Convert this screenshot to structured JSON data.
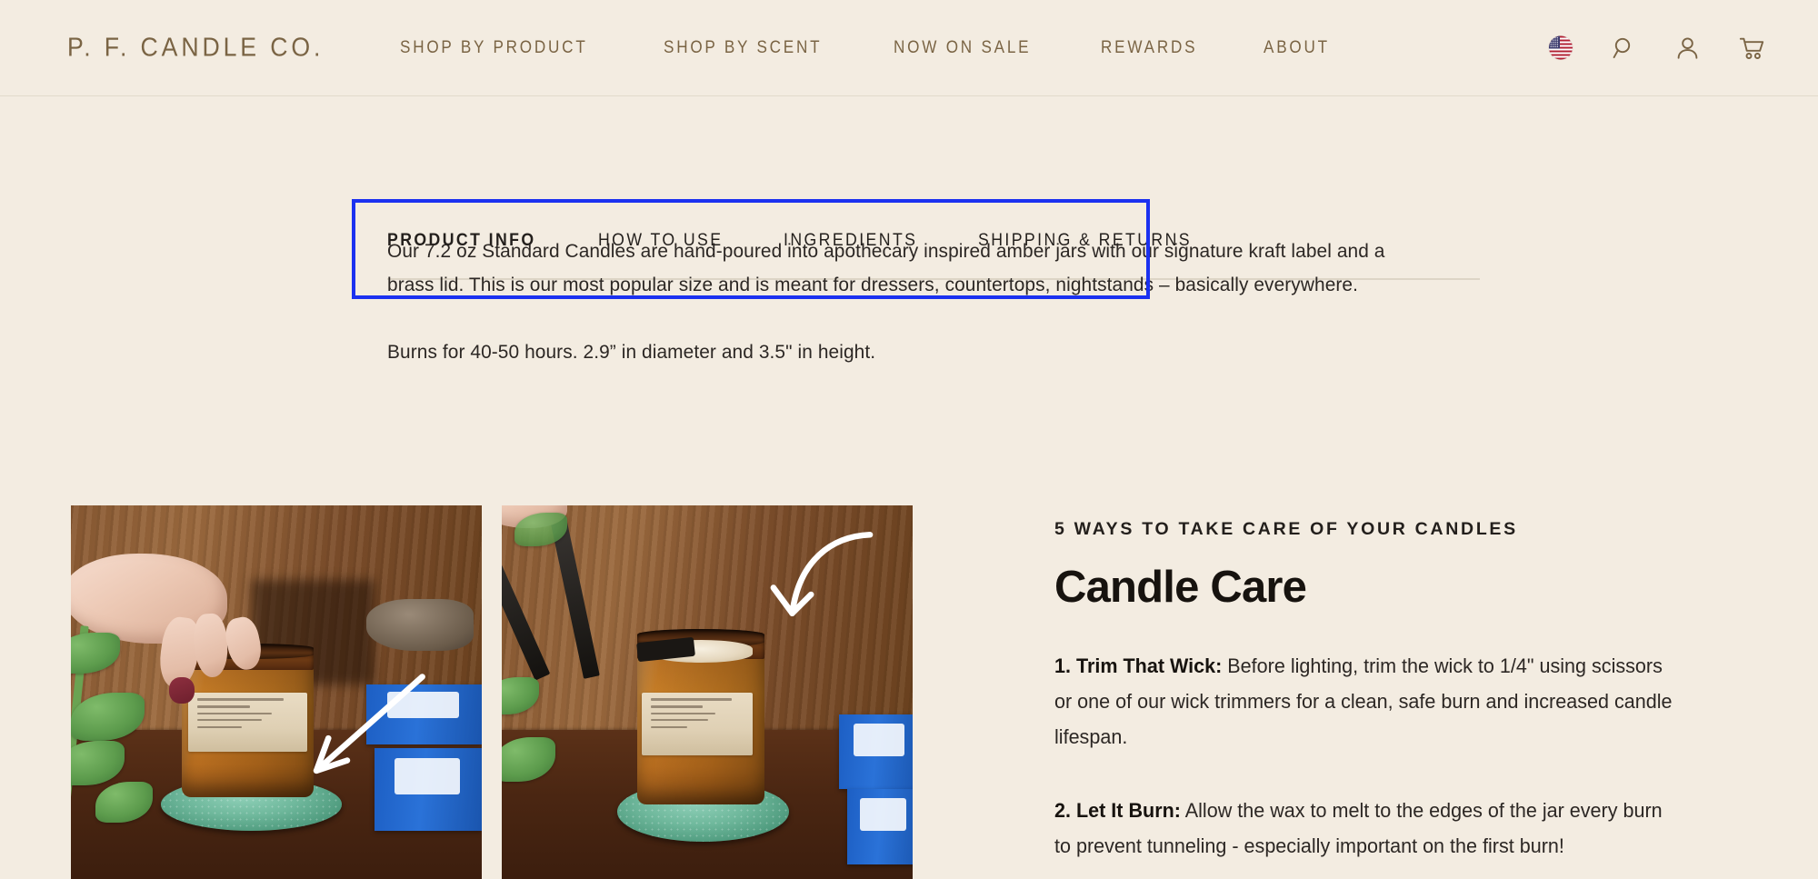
{
  "header": {
    "logo": "P. F. CANDLE CO.",
    "nav": [
      {
        "label": "SHOP BY PRODUCT",
        "name": "nav-shop-by-product"
      },
      {
        "label": "SHOP BY SCENT",
        "name": "nav-shop-by-scent"
      },
      {
        "label": "NOW ON SALE",
        "name": "nav-now-on-sale"
      },
      {
        "label": "REWARDS",
        "name": "nav-rewards"
      },
      {
        "label": "ABOUT",
        "name": "nav-about"
      }
    ],
    "icons": [
      {
        "name": "us-flag-icon",
        "label": "US"
      },
      {
        "name": "search-icon",
        "label": "Search"
      },
      {
        "name": "account-icon",
        "label": "Account"
      },
      {
        "name": "cart-icon",
        "label": "Cart"
      }
    ]
  },
  "tabs": {
    "items": [
      {
        "label": "PRODUCT INFO",
        "active": true
      },
      {
        "label": "HOW TO USE",
        "active": false
      },
      {
        "label": "INGREDIENTS",
        "active": false
      },
      {
        "label": "SHIPPING & RETURNS",
        "active": false
      }
    ],
    "highlight_color": "#1b31f0"
  },
  "product_info": {
    "paragraph_1": "Our 7.2 oz Standard Candles are hand-poured into apothecary inspired amber jars with our signature kraft label and a brass lid. This is our most popular size and is meant for dressers, countertops, nightstands – basically everywhere.",
    "paragraph_2": "Burns for 40-50 hours. 2.9” in diameter and 3.5\" in height."
  },
  "care": {
    "eyebrow": "5 WAYS TO TAKE CARE OF YOUR CANDLES",
    "title": "Candle Care",
    "items": [
      {
        "lead": "1. Trim That Wick:",
        "body": " Before lighting, trim the wick to 1/4\" using scissors or one of our wick trimmers for a clean, safe burn and increased candle lifespan."
      },
      {
        "lead": "2. Let It Burn:",
        "body": " Allow the wax to melt to the edges of the jar every burn to prevent tunneling - especially important on the first burn!"
      }
    ]
  },
  "photos": [
    {
      "name": "photo-hand-removing-lid",
      "alt": "Hand reaching into an amber candle jar on a green coaster with plant and blue boxes",
      "label_text": "AMBER & MOSS SOY CANDLE POURED IN CALIFORNIA WITH 100% SOY WAX P. F. CANDLE CO."
    },
    {
      "name": "photo-trimming-wick",
      "alt": "Black wick trimmers trimming the wick of an amber candle on a green coaster",
      "label_text": "AMBER & MOSS SOY CANDLE POURED IN CALIFORNIA WITH 100% SOY WAX P. F. CANDLE CO."
    }
  ],
  "colors": {
    "page_background": "#f3ece1",
    "brand_brown": "#7a6444",
    "text_dark": "#231f1c",
    "highlight_blue": "#1b31f0",
    "rule": "#ddd5c6"
  }
}
